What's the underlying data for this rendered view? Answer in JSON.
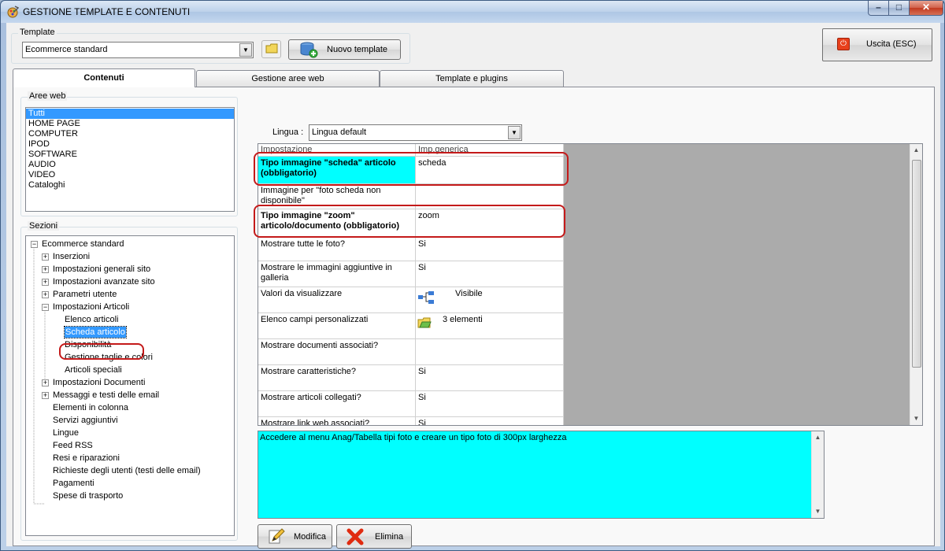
{
  "window": {
    "title": "GESTIONE TEMPLATE E CONTENUTI"
  },
  "template_group": {
    "label": "Template",
    "selected": "Ecommerce standard",
    "new_button": "Nuovo template"
  },
  "exit_button": "Uscita (ESC)",
  "tabs": [
    {
      "label": "Contenuti",
      "active": true
    },
    {
      "label": "Gestione aree web",
      "active": false
    },
    {
      "label": "Template e plugins",
      "active": false
    }
  ],
  "aree_web": {
    "label": "Aree web",
    "items": [
      "Tutti",
      "HOME PAGE",
      "COMPUTER",
      "IPOD",
      "SOFTWARE",
      "AUDIO",
      "VIDEO",
      "Cataloghi"
    ],
    "selected_index": 0
  },
  "sezioni": {
    "label": "Sezioni",
    "root": "Ecommerce standard",
    "nodes": [
      {
        "label": "Inserzioni",
        "level": 1,
        "expander": "+"
      },
      {
        "label": "Impostazioni generali sito",
        "level": 1,
        "expander": "+"
      },
      {
        "label": "Impostazioni avanzate sito",
        "level": 1,
        "expander": "+"
      },
      {
        "label": "Parametri utente",
        "level": 1,
        "expander": "+"
      },
      {
        "label": "Impostazioni Articoli",
        "level": 1,
        "expander": "-"
      },
      {
        "label": "Elenco articoli",
        "level": 2,
        "expander": ""
      },
      {
        "label": "Scheda articolo",
        "level": 2,
        "expander": "",
        "selected": true
      },
      {
        "label": "Disponibilità",
        "level": 2,
        "expander": ""
      },
      {
        "label": "Gestione taglie e colori",
        "level": 2,
        "expander": ""
      },
      {
        "label": "Articoli speciali",
        "level": 2,
        "expander": ""
      },
      {
        "label": "Impostazioni Documenti",
        "level": 1,
        "expander": "+"
      },
      {
        "label": "Messaggi e testi delle email",
        "level": 1,
        "expander": "+"
      },
      {
        "label": "Elementi in colonna",
        "level": 1,
        "expander": ""
      },
      {
        "label": "Servizi aggiuntivi",
        "level": 1,
        "expander": ""
      },
      {
        "label": "Lingue",
        "level": 1,
        "expander": ""
      },
      {
        "label": "Feed RSS",
        "level": 1,
        "expander": ""
      },
      {
        "label": "Resi e riparazioni",
        "level": 1,
        "expander": ""
      },
      {
        "label": "Richieste degli utenti (testi delle email)",
        "level": 1,
        "expander": ""
      },
      {
        "label": "Pagamenti",
        "level": 1,
        "expander": ""
      },
      {
        "label": "Spese di trasporto",
        "level": 1,
        "expander": ""
      }
    ]
  },
  "lingua": {
    "label": "Lingua :",
    "selected": "Lingua default"
  },
  "grid": {
    "headers": [
      "Impostazione",
      "Imp.generica"
    ],
    "rows": [
      {
        "name": "Tipo immagine \"scheda\" articolo (obbligatorio)",
        "value": "scheda",
        "highlight": true
      },
      {
        "name": "Immagine per \"foto scheda non disponibile\"",
        "value": ""
      },
      {
        "name": "Tipo immagine \"zoom\" articolo/documento (obbligatorio)",
        "value": "zoom",
        "bold": true
      },
      {
        "name": "Mostrare tutte le foto?",
        "value": "Si"
      },
      {
        "name": "Mostrare le immagini aggiuntive in galleria",
        "value": "Si"
      },
      {
        "name": "Valori da visualizzare",
        "value": "Visibile",
        "icon": "tree-icon"
      },
      {
        "name": "Elenco campi personalizzati",
        "value": "3 elementi",
        "icon": "folder-icon"
      },
      {
        "name": "Mostrare documenti associati?",
        "value": ""
      },
      {
        "name": "Mostrare caratteristiche?",
        "value": "Si"
      },
      {
        "name": "Mostrare articoli collegati?",
        "value": "Si"
      },
      {
        "name": "Mostrare link web associati?",
        "value": "Si"
      }
    ]
  },
  "description": "Accedere al menu Anag/Tabella tipi foto e creare un tipo foto di 300px larghezza",
  "buttons": {
    "modifica": "Modifica",
    "elimina": "Elimina"
  },
  "colors": {
    "highlight": "#00ffff",
    "selection": "#3399ff",
    "annotation": "#c41a1a"
  }
}
